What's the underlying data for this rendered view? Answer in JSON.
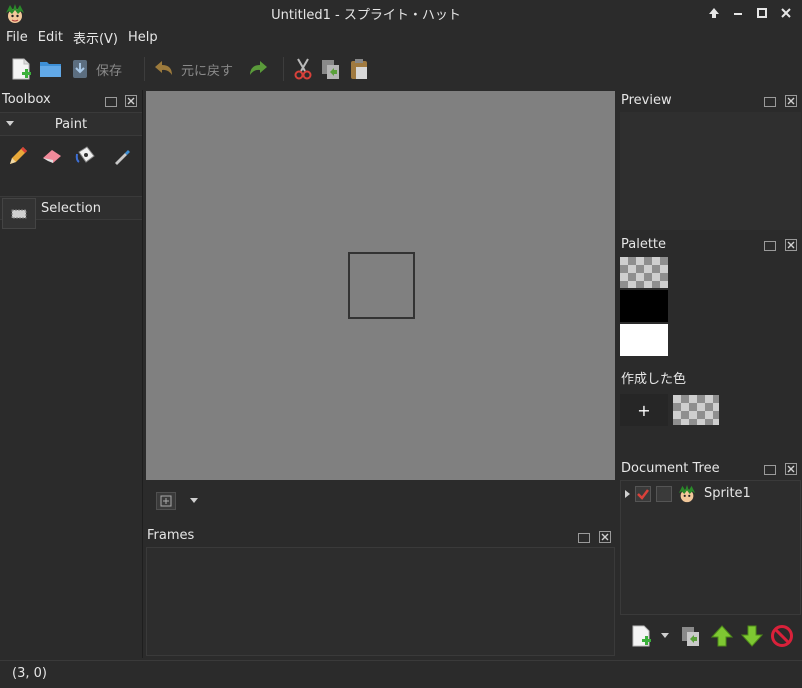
{
  "window": {
    "title": "Untitled1 - スプライト・ハット"
  },
  "menu": {
    "items": [
      "File",
      "Edit",
      "表示(V)",
      "Help"
    ]
  },
  "toolbar": {
    "save_label": "保存",
    "undo_label": "元に戻す"
  },
  "toolbox": {
    "title": "Toolbox",
    "sections": [
      {
        "label": "Paint"
      },
      {
        "label": "Selection"
      }
    ]
  },
  "frames": {
    "title": "Frames"
  },
  "preview": {
    "title": "Preview"
  },
  "palette": {
    "title": "Palette",
    "created_colors_label": "作成した色",
    "add_label": "+"
  },
  "document_tree": {
    "title": "Document Tree",
    "items": [
      {
        "label": "Sprite1",
        "visible": true,
        "locked": false
      }
    ]
  },
  "status": {
    "coords": "(3, 0)"
  },
  "colors": {
    "background": "#2b2b2b",
    "canvas": "#808080",
    "accent_red": "#d9413a",
    "arrow_green": "#7ec832"
  }
}
